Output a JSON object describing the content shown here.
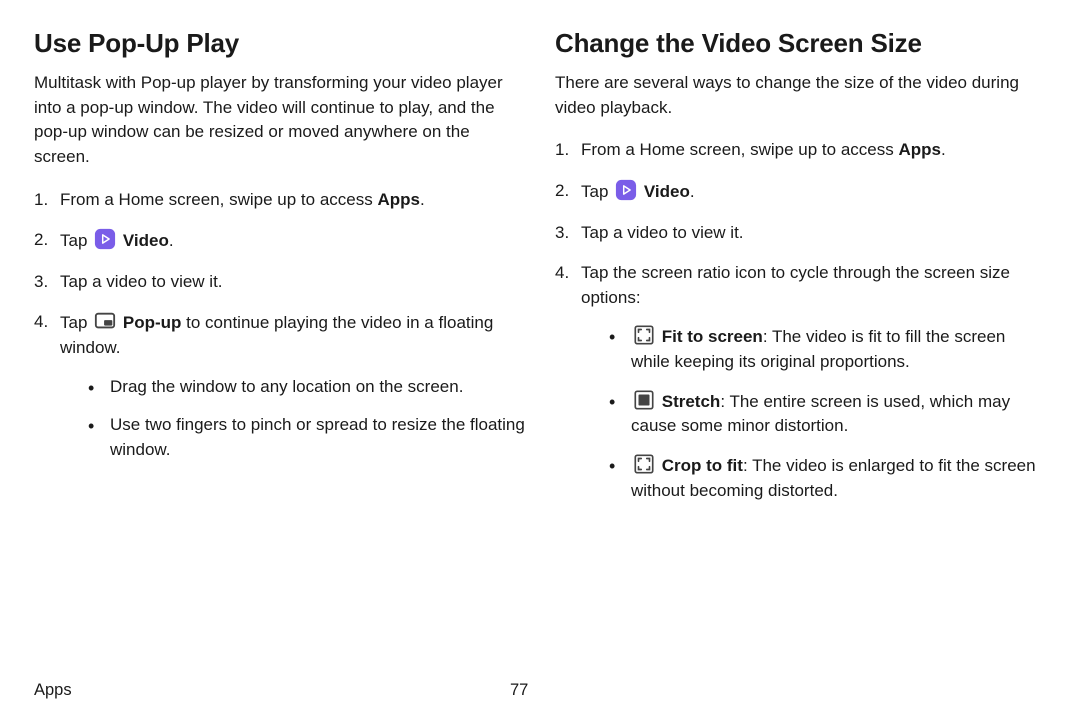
{
  "left": {
    "heading": "Use Pop-Up Play",
    "intro": "Multitask with Pop-up player by transforming your video player into a pop-up window. The video will continue to play, and the pop-up window can be resized or moved anywhere on the screen.",
    "s1_a": "From a Home screen, swipe up to access ",
    "s1_b": "Apps",
    "s1_c": ".",
    "s2_a": "Tap ",
    "s2_b": "Video",
    "s2_c": ".",
    "s3": "Tap a video to view it.",
    "s4_a": "Tap ",
    "s4_b": "Pop-up",
    "s4_c": " to continue playing the video in a floating window.",
    "s4_sub1": "Drag the window to any location on the screen.",
    "s4_sub2": "Use two fingers to pinch or spread to resize the floating window."
  },
  "right": {
    "heading": "Change the Video Screen Size",
    "intro": "There are several ways to change the size of the video during video playback.",
    "s1_a": "From a Home screen, swipe up to access ",
    "s1_b": "Apps",
    "s1_c": ".",
    "s2_a": "Tap ",
    "s2_b": "Video",
    "s2_c": ".",
    "s3": "Tap a video to view it.",
    "s4": "Tap the screen ratio icon to cycle through the screen size options:",
    "b1_a": "Fit to screen",
    "b1_b": ": The video is fit to fill the screen while keeping its original proportions.",
    "b2_a": "Stretch",
    "b2_b": ": The entire screen is used, which may cause some minor distortion.",
    "b3_a": "Crop to fit",
    "b3_b": ": The video is enlarged to fit the screen without becoming distorted."
  },
  "footer": {
    "section": "Apps",
    "page": "77"
  }
}
